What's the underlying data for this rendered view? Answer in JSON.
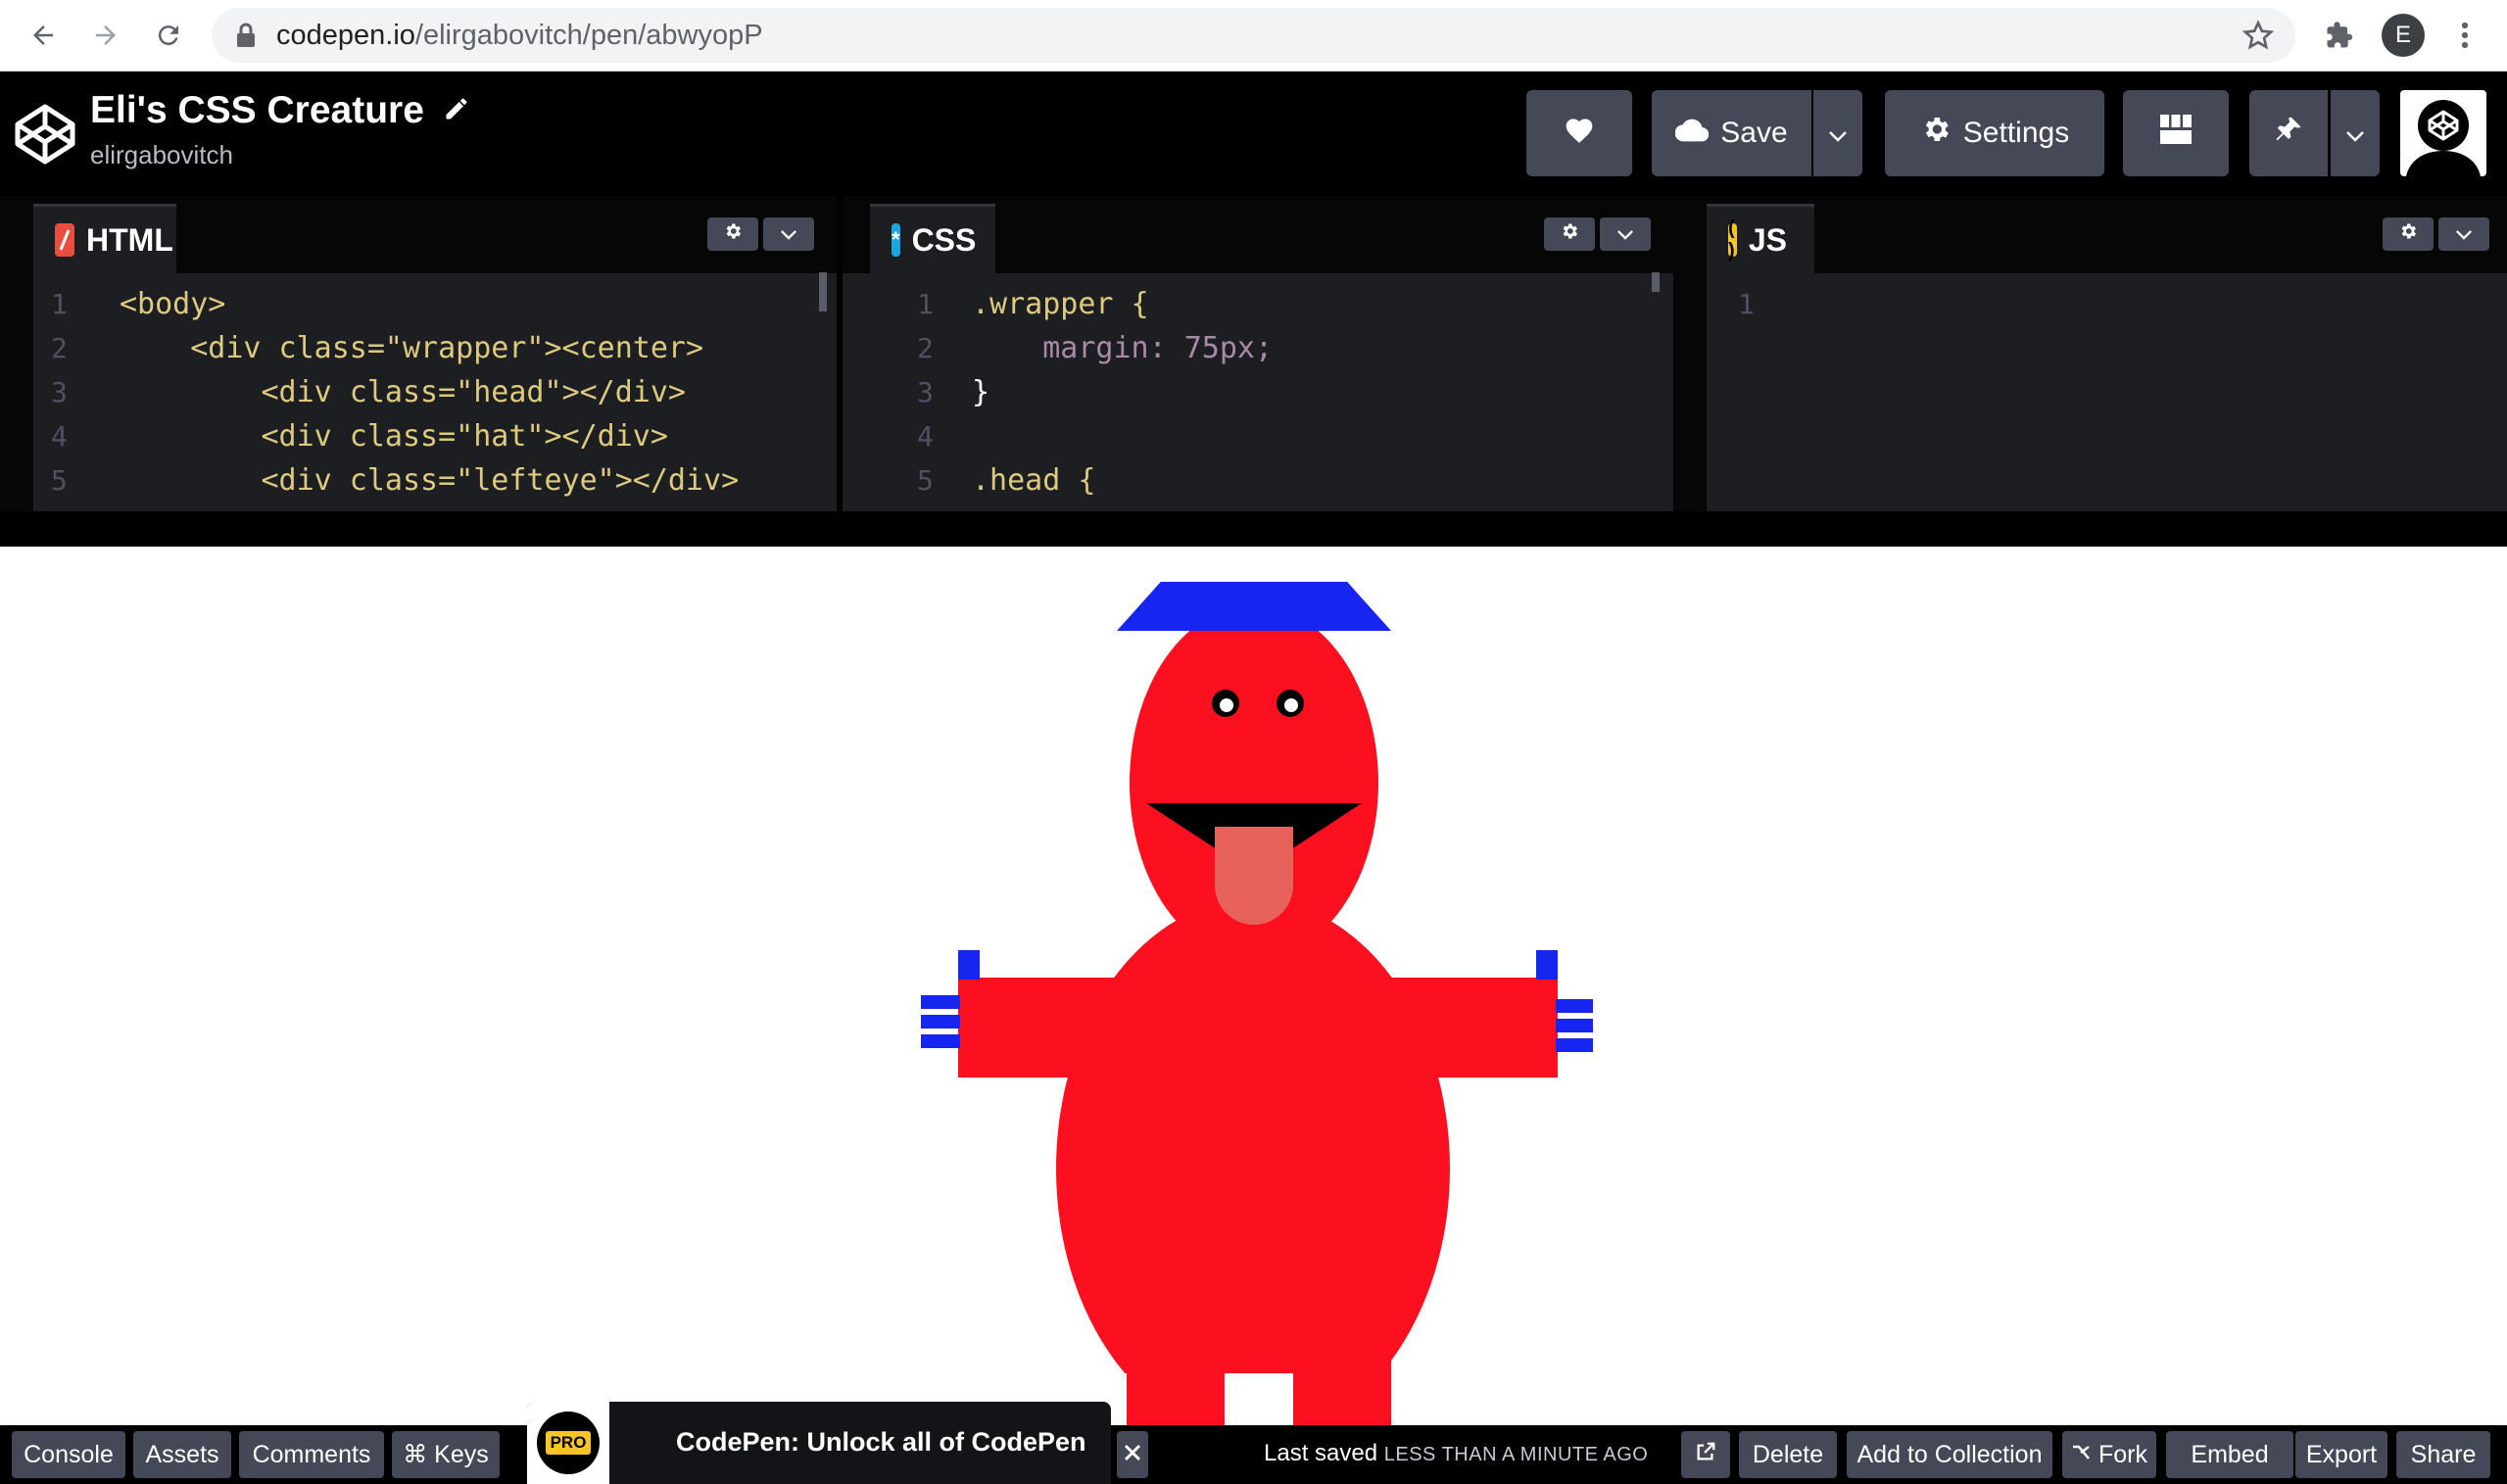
{
  "browser": {
    "url_host": "codepen.io",
    "url_path": "/elirgabovitch/pen/abwyopP",
    "profile_initial": "E"
  },
  "header": {
    "title": "Eli's CSS Creature",
    "username": "elirgabovitch",
    "save_label": "Save",
    "settings_label": "Settings"
  },
  "editors": {
    "html": {
      "label": "HTML",
      "lines": [
        {
          "n": "1",
          "text": "<body>"
        },
        {
          "n": "2",
          "text": "    <div class=\"wrapper\"><center>"
        },
        {
          "n": "3",
          "text": "        <div class=\"head\"></div>"
        },
        {
          "n": "4",
          "text": "        <div class=\"hat\"></div>"
        },
        {
          "n": "5",
          "text": "        <div class=\"lefteye\"></div>"
        }
      ]
    },
    "css": {
      "label": "CSS",
      "lines": [
        {
          "n": "1",
          "text": ".wrapper {"
        },
        {
          "n": "2",
          "text": "    margin: 75px;"
        },
        {
          "n": "3",
          "text": "}"
        },
        {
          "n": "4",
          "text": ""
        },
        {
          "n": "5",
          "text": ".head {"
        }
      ]
    },
    "js": {
      "label": "JS",
      "lines": [
        {
          "n": "1",
          "text": ""
        }
      ]
    }
  },
  "footer": {
    "left_buttons": [
      "Console",
      "Assets",
      "Comments",
      "⌘ Keys"
    ],
    "promo_badge": "PRO",
    "promo_text": "CodePen: Unlock all of CodePen",
    "saved_prefix": "Last saved",
    "saved_time": "LESS THAN A MINUTE AGO",
    "right_buttons": [
      "Delete",
      "Add to Collection",
      "Fork",
      "Embed",
      "Export",
      "Share"
    ]
  },
  "colors": {
    "creature_red": "#fc0f1f",
    "hat_blue": "#1725f0",
    "tongue": "#e8625c",
    "html_badge": "#e84d3d",
    "css_badge": "#1ba6e0",
    "js_badge": "#f7c624"
  },
  "icons": [
    "back-arrow-icon",
    "forward-arrow-icon",
    "reload-icon",
    "lock-icon",
    "star-icon",
    "extensions-icon",
    "more-icon",
    "codepen-logo-icon",
    "pencil-icon",
    "heart-icon",
    "cloud-icon",
    "chevron-down-icon",
    "gear-icon",
    "layout-icon",
    "pin-icon",
    "close-icon",
    "external-link-icon",
    "fork-icon"
  ]
}
